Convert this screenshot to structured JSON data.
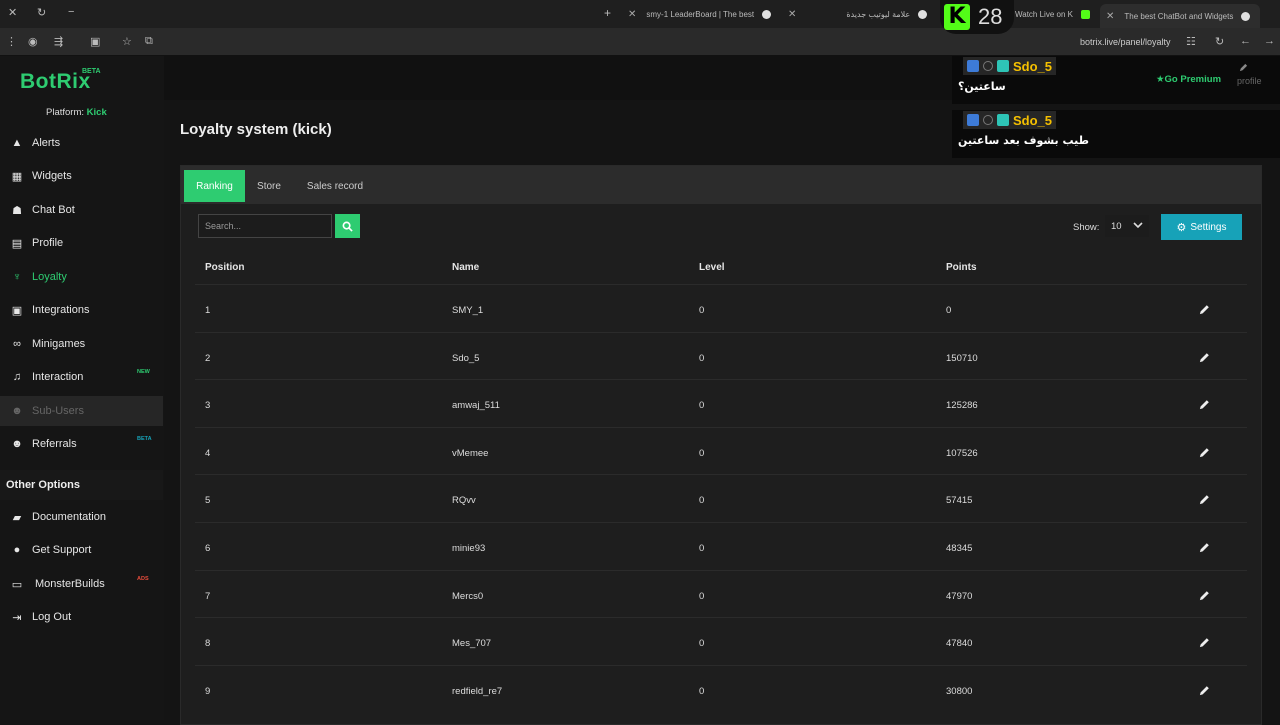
{
  "browser": {
    "tabs": [
      {
        "label": "smy-1 LeaderBoard | The best",
        "active": false
      },
      {
        "label": "علامة ليوتيب جديدة",
        "active": false
      },
      {
        "label": "Watch Live on K",
        "active": false
      },
      {
        "label": "The best ChatBot and Widgets",
        "active": true
      }
    ],
    "kick_badge_count": "28",
    "url": "botrix.live/panel/loyalty"
  },
  "brand": {
    "name": "BotRix",
    "beta": "BETA",
    "platform_label": "Platform:",
    "platform_value": "Kick"
  },
  "nav": [
    {
      "label": "Alerts",
      "icon": "warning-icon"
    },
    {
      "label": "Widgets",
      "icon": "grid-icon"
    },
    {
      "label": "Chat Bot",
      "icon": "robot-icon"
    },
    {
      "label": "Profile",
      "icon": "id-card-icon"
    },
    {
      "label": "Loyalty",
      "icon": "trophy-icon"
    },
    {
      "label": "Integrations",
      "icon": "plug-icon"
    },
    {
      "label": "Minigames",
      "icon": "gamepad-icon"
    },
    {
      "label": "Interaction",
      "icon": "music-icon",
      "badge": "NEW"
    },
    {
      "label": "Sub-Users",
      "icon": "users-icon"
    },
    {
      "label": "Referrals",
      "icon": "group-icon",
      "badge": "BETA"
    }
  ],
  "other_options": {
    "title": "Other Options",
    "items": [
      {
        "label": "Documentation",
        "icon": "book-icon"
      },
      {
        "label": "Get Support",
        "icon": "question-icon"
      },
      {
        "label": "MonsterBuilds",
        "icon": "laptop-icon",
        "badge": "ADS"
      },
      {
        "label": "Log Out",
        "icon": "logout-icon"
      }
    ]
  },
  "header": {
    "go_premium": "Go Premium",
    "profile": "profile"
  },
  "page": {
    "title": "Loyalty system (kick)"
  },
  "tabs": [
    "Ranking",
    "Store",
    "Sales record"
  ],
  "search": {
    "placeholder": "Search..."
  },
  "show": {
    "label": "Show:",
    "value": "10"
  },
  "settings_label": "Settings",
  "table": {
    "headers": [
      "Position",
      "Name",
      "Level",
      "Points"
    ],
    "rows": [
      [
        "1",
        "SMY_1",
        "0",
        "0"
      ],
      [
        "2",
        "Sdo_5",
        "0",
        "150710"
      ],
      [
        "3",
        "amwaj_511",
        "0",
        "125286"
      ],
      [
        "4",
        "vMemee",
        "0",
        "107526"
      ],
      [
        "5",
        "RQvv",
        "0",
        "57415"
      ],
      [
        "6",
        "minie93",
        "0",
        "48345"
      ],
      [
        "7",
        "Mercs0",
        "0",
        "47970"
      ],
      [
        "8",
        "Mes_707",
        "0",
        "47840"
      ],
      [
        "9",
        "redfield_re7",
        "0",
        "30800"
      ]
    ]
  },
  "chat": [
    {
      "user": "Sdo_5",
      "message": "ساعتين؟"
    },
    {
      "user": "Sdo_5",
      "message": "طيب بشوف بعد ساعتين"
    }
  ],
  "colors": {
    "accent": "#2ecc71",
    "settings": "#17a2b8",
    "chat_name": "#f5c000",
    "kick": "#53fc18"
  }
}
